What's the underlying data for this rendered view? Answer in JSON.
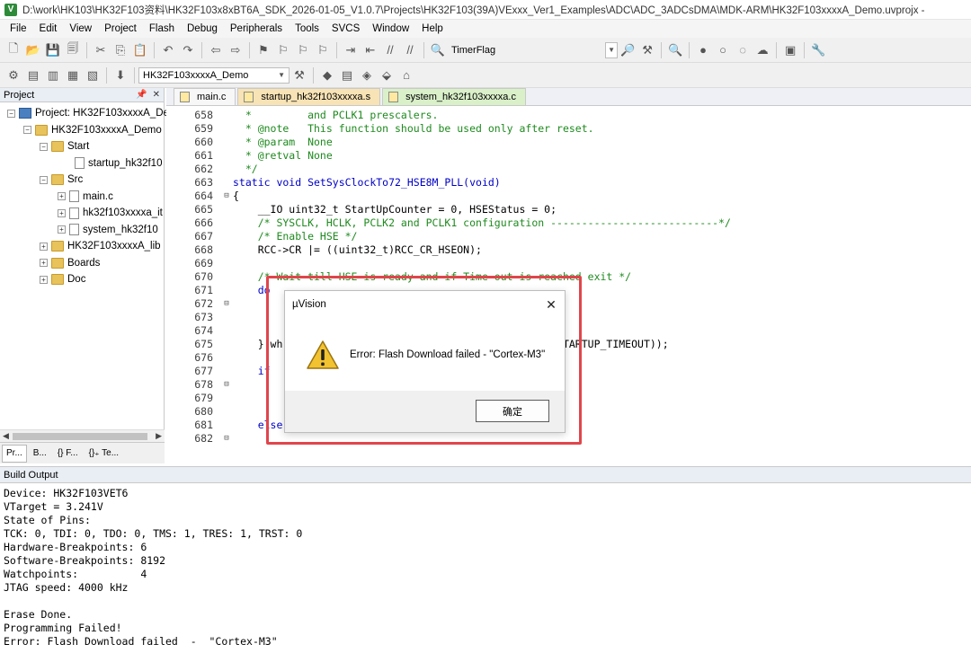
{
  "window": {
    "title": "D:\\work\\HK103\\HK32F103资料\\HK32F103x8xBT6A_SDK_2026-01-05_V1.0.7\\Projects\\HK32F103(39A)VExxx_Ver1_Examples\\ADC\\ADC_3ADCsDMA\\MDK-ARM\\HK32F103xxxxA_Demo.uvprojx -"
  },
  "menu": [
    "File",
    "Edit",
    "View",
    "Project",
    "Flash",
    "Debug",
    "Peripherals",
    "Tools",
    "SVCS",
    "Window",
    "Help"
  ],
  "toolbar": {
    "find_text": "TimerFlag",
    "target_select": "HK32F103xxxxA_Demo"
  },
  "project_pane": {
    "title": "Project",
    "tree": [
      {
        "label": "Project: HK32F103xxxxA_De",
        "exp": "⊟",
        "icon": "project"
      },
      {
        "label": "HK32F103xxxxA_Demo",
        "exp": "⊟",
        "icon": "folder"
      },
      {
        "label": "Start",
        "exp": "⊟",
        "icon": "folder"
      },
      {
        "label": "startup_hk32f10",
        "exp": "",
        "icon": "file"
      },
      {
        "label": "Src",
        "exp": "⊟",
        "icon": "folder"
      },
      {
        "label": "main.c",
        "exp": "⊞",
        "icon": "file"
      },
      {
        "label": "hk32f103xxxxa_it",
        "exp": "⊞",
        "icon": "file"
      },
      {
        "label": "system_hk32f10",
        "exp": "⊞",
        "icon": "file"
      },
      {
        "label": "HK32F103xxxxA_lib",
        "exp": "⊞",
        "icon": "folder"
      },
      {
        "label": "Boards",
        "exp": "⊞",
        "icon": "folder"
      },
      {
        "label": "Doc",
        "exp": "⊞",
        "icon": "folder"
      }
    ],
    "tabs": [
      "Pr...",
      "B...",
      "{} F...",
      "{}₊ Te..."
    ]
  },
  "editor": {
    "tabs": [
      {
        "label": "main.c",
        "state": "normal"
      },
      {
        "label": "startup_hk32f103xxxxa.s",
        "state": "orange"
      },
      {
        "label": "system_hk32f103xxxxa.c",
        "state": "active"
      }
    ],
    "lines": [
      {
        "n": "658",
        "fold": "",
        "text": "  *         and PCLK1 prescalers.",
        "cls": "c-comment"
      },
      {
        "n": "659",
        "fold": "",
        "text": "  * @note   This function should be used only after reset.",
        "cls": "c-comment"
      },
      {
        "n": "660",
        "fold": "",
        "text": "  * @param  None",
        "cls": "c-comment"
      },
      {
        "n": "661",
        "fold": "",
        "text": "  * @retval None",
        "cls": "c-comment"
      },
      {
        "n": "662",
        "fold": "",
        "text": "  */",
        "cls": "c-comment"
      },
      {
        "n": "663",
        "fold": "",
        "text": "static void SetSysClockTo72_HSE8M_PLL(void)",
        "cls": "c-kw"
      },
      {
        "n": "664",
        "fold": "⊟",
        "text": "{",
        "cls": "ctext"
      },
      {
        "n": "665",
        "fold": "",
        "text": "    __IO uint32_t StartUpCounter = 0, HSEStatus = 0;",
        "cls": "ctext"
      },
      {
        "n": "666",
        "fold": "",
        "text": "    /* SYSCLK, HCLK, PCLK2 and PCLK1 configuration ---------------------------*/",
        "cls": "c-comment"
      },
      {
        "n": "667",
        "fold": "",
        "text": "    /* Enable HSE */",
        "cls": "c-comment"
      },
      {
        "n": "668",
        "fold": "",
        "text": "    RCC->CR |= ((uint32_t)RCC_CR_HSEON);",
        "cls": "ctext"
      },
      {
        "n": "669",
        "fold": "",
        "text": "",
        "cls": "ctext"
      },
      {
        "n": "670",
        "fold": "",
        "text": "    /* Wait till HSE is ready and if Time out is reached exit */",
        "cls": "c-comment"
      },
      {
        "n": "671",
        "fold": "",
        "text": "    do",
        "cls": "c-kw"
      },
      {
        "n": "672",
        "fold": "⊟",
        "text": "",
        "cls": "ctext"
      },
      {
        "n": "673",
        "fold": "",
        "text": "",
        "cls": "ctext"
      },
      {
        "n": "674",
        "fold": "",
        "text": "",
        "cls": "ctext"
      },
      {
        "n": "675",
        "fold": "",
        "text": "    } wh                                     != HSE_STARTUP_TIMEOUT));",
        "cls": "ctext"
      },
      {
        "n": "676",
        "fold": "",
        "text": "",
        "cls": "ctext"
      },
      {
        "n": "677",
        "fold": "",
        "text": "    if",
        "cls": "c-kw"
      },
      {
        "n": "678",
        "fold": "⊟",
        "text": "",
        "cls": "ctext"
      },
      {
        "n": "679",
        "fold": "",
        "text": "",
        "cls": "ctext"
      },
      {
        "n": "680",
        "fold": "",
        "text": "",
        "cls": "ctext"
      },
      {
        "n": "681",
        "fold": "",
        "text": "    else",
        "cls": "c-kw"
      },
      {
        "n": "682",
        "fold": "⊟",
        "text": "",
        "cls": "ctext"
      }
    ]
  },
  "build_output": {
    "title": "Build Output",
    "lines": [
      "Device: HK32F103VET6",
      "VTarget = 3.241V",
      "State of Pins:",
      "TCK: 0, TDI: 0, TDO: 0, TMS: 1, TRES: 1, TRST: 0",
      "Hardware-Breakpoints: 6",
      "Software-Breakpoints: 8192",
      "Watchpoints:          4",
      "JTAG speed: 4000 kHz",
      "",
      "Erase Done.",
      "Programming Failed!",
      "Error: Flash Download failed  -  \"Cortex-M3\""
    ]
  },
  "dialog": {
    "title": "µVision",
    "message": "Error: Flash Download failed  -  \"Cortex-M3\"",
    "ok_label": "确定",
    "close_glyph": "✕"
  },
  "colors": {
    "highlight": "#e0454b",
    "comment": "#1e8a1e",
    "keyword": "#0000c8"
  }
}
